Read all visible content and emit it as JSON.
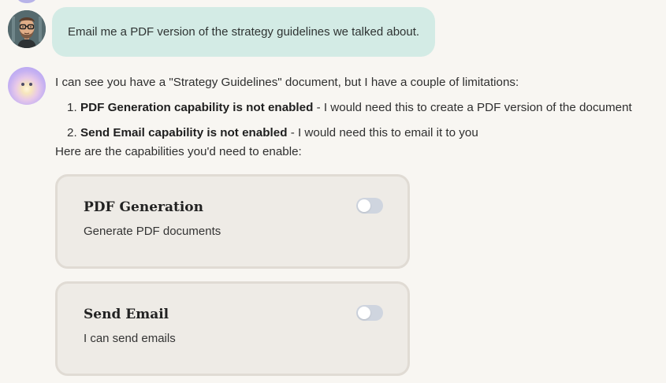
{
  "conversation": {
    "user_message": "Email me a PDF version of the strategy guidelines we talked about.",
    "assistant": {
      "intro": "I can see you have a \"Strategy Guidelines\" document, but I have a couple of limitations:",
      "limitations": [
        {
          "number": "1.",
          "bold": "PDF Generation capability is not enabled",
          "rest": " - I would need this to create a PDF version of the document"
        },
        {
          "number": "2.",
          "bold": "Send Email capability is not enabled",
          "rest": " - I would need this to email it to you"
        }
      ],
      "need_enable": "Here are the capabilities you'd need to enable:"
    }
  },
  "capabilities": [
    {
      "title": "PDF Generation",
      "description": "Generate PDF documents",
      "enabled": false
    },
    {
      "title": "Send Email",
      "description": "I can send emails",
      "enabled": false
    }
  ],
  "colors": {
    "background": "#f8f6f2",
    "user_bubble": "#d3ebe5",
    "card_background": "#eeebe6",
    "card_border": "#e0dbd4",
    "toggle_off": "#cfd5df"
  }
}
